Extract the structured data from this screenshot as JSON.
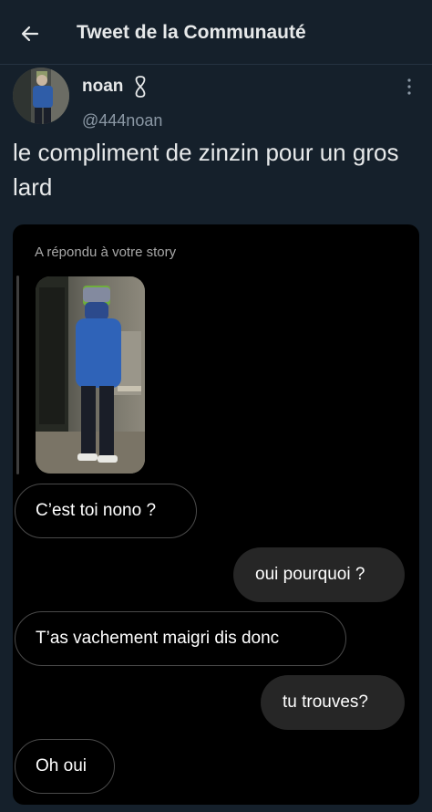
{
  "header": {
    "title": "Tweet de la Communauté",
    "back_icon": "arrow-left-icon"
  },
  "tweet": {
    "display_name": "noan",
    "badge_icon": "infinity-icon",
    "handle": "@444noan",
    "more_icon": "more-vertical-icon",
    "text": "le compliment de zinzin pour un gros lard"
  },
  "dm": {
    "story_label": "A répondu à votre story",
    "messages": [
      {
        "from": "them",
        "text": "C’est toi nono ?"
      },
      {
        "from": "me",
        "text": "oui pourquoi ?"
      },
      {
        "from": "them",
        "text": "T’as vachement maigri dis donc"
      },
      {
        "from": "me",
        "text": "tu trouves?"
      },
      {
        "from": "them",
        "text": "Oh oui"
      }
    ]
  },
  "colors": {
    "background": "#15202b",
    "dm_background": "#000000",
    "sent_bubble": "#262626"
  }
}
